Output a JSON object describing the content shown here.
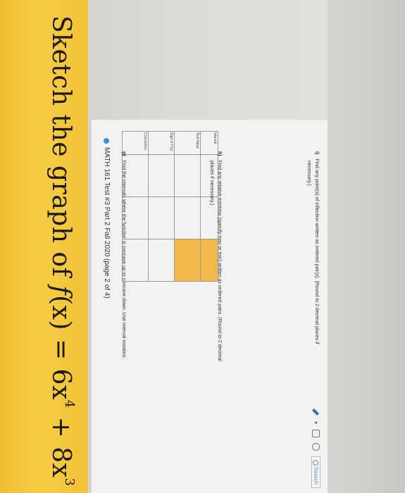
{
  "title": {
    "prefix": "Sketch the graph of ",
    "fn": "f",
    "arg": "(x) = 6x",
    "exp1": "4",
    "plus": " + 8x",
    "exp2": "3"
  },
  "doc_header": "MATH 161 Test #3 Part 2 Fall 2020 (page 2 of 4)",
  "toolbar": {
    "search_label": "Search"
  },
  "questions": {
    "g": {
      "label": "g)",
      "text": "Find the intervals where the function is concave up or concave down. Use interval notation."
    },
    "h": {
      "label": "h)",
      "text": "Find any relative extrema (specify max or min) written as ordered pairs. (Round to 2 decimal",
      "text2": "places if necessary.)"
    },
    "i": {
      "label": "i)",
      "text": "Find any point(s) of inflection written as ordered pair(s). (Round to 2 decimal places if",
      "text2": "necessary.)"
    }
  },
  "table": {
    "rows": [
      "Interval",
      "Test Value",
      "Sign of f''(x)",
      "Conclusion"
    ]
  },
  "colors": {
    "banner": "#f4c63a",
    "highlight": "#f2b84a"
  }
}
